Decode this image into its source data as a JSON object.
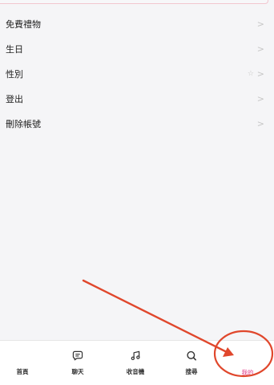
{
  "menu": {
    "items": [
      {
        "label": "免費禮物"
      },
      {
        "label": "生日"
      },
      {
        "label": "性別"
      },
      {
        "label": "登出"
      },
      {
        "label": "刪除帳號"
      }
    ],
    "chevron": ">",
    "star": "☆"
  },
  "tabbar": {
    "tabs": [
      {
        "label": "首頁",
        "icon": "home-icon"
      },
      {
        "label": "聊天",
        "icon": "chat-icon"
      },
      {
        "label": "收音機",
        "icon": "music-note-icon"
      },
      {
        "label": "搜尋",
        "icon": "search-icon"
      },
      {
        "label": "我的",
        "icon": "profile-icon"
      }
    ],
    "active_color": "#e23a86"
  },
  "annotation": {
    "color": "#e0472c"
  }
}
